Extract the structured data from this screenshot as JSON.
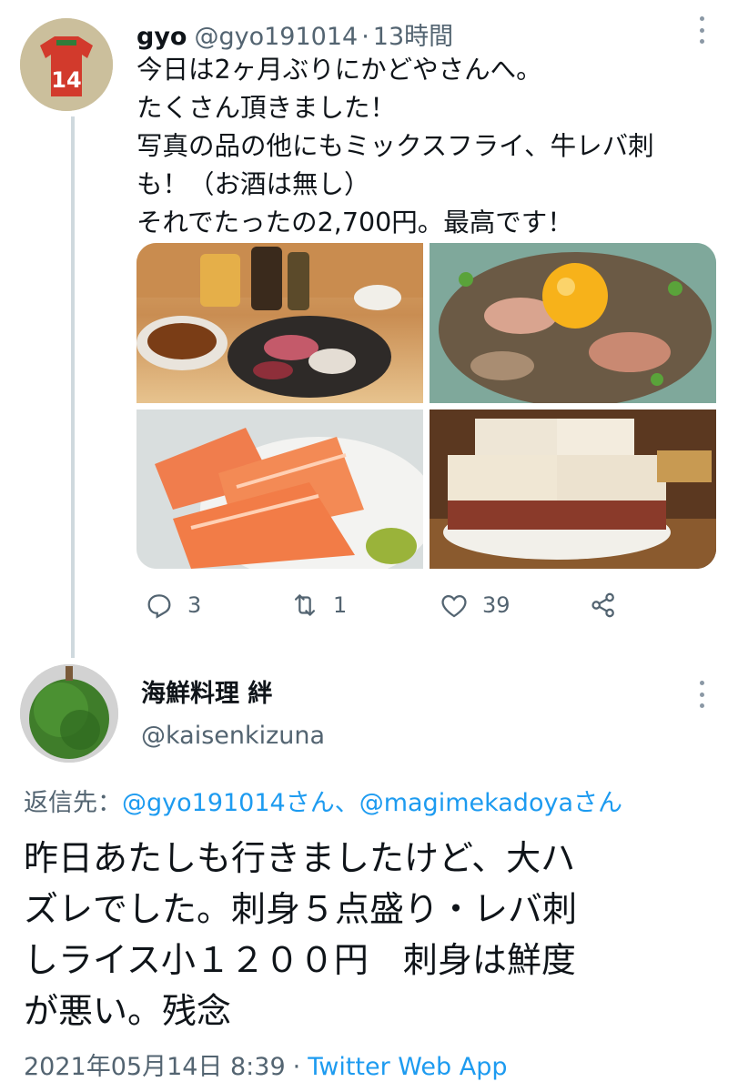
{
  "tweet1": {
    "name": "gyo",
    "handle": "@gyo191014",
    "separator": "·",
    "time": "13時間",
    "lines": [
      "今日は2ヶ月ぶりにかどやさんへ。",
      "たくさん頂きました！",
      "写真の品の他にもミックスフライ、牛レバ刺",
      "も！（お酒は無し）",
      "それでたったの2,700円。最高です！"
    ],
    "media": [
      {
        "icon": "food-photo-sashimi-platter"
      },
      {
        "icon": "food-photo-egg-yolk-bowl"
      },
      {
        "icon": "food-photo-salmon-sashimi"
      },
      {
        "icon": "food-photo-katsu-sandwich"
      }
    ],
    "actions": {
      "reply_count": "3",
      "retweet_count": "1",
      "like_count": "39"
    }
  },
  "tweet2": {
    "name": "海鮮料理 絆",
    "handle": "@kaisenkizuna",
    "reply_prefix": "返信先：",
    "reply_targets": "@gyo191014さん、@magimekadoyaさん",
    "lines": [
      "昨日あたしも行きましたけど、大ハ",
      "ズレでした。刺身５点盛り・レバ刺",
      "しライス小１２００円　刺身は鮮度",
      "が悪い。残念"
    ],
    "date": "2021年05月14日 8:39",
    "separator": "·",
    "app": "Twitter Web App"
  },
  "colors": {
    "text": "#0f1419",
    "secondary": "#536471",
    "link": "#1d9bf0",
    "thread_line": "#cfd9de"
  }
}
